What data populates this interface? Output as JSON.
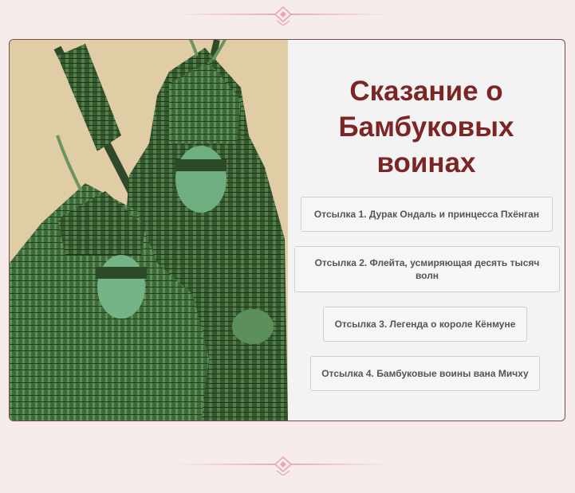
{
  "title": "Сказание о Бамбуковых воинах",
  "references": [
    {
      "label": "Отсылка 1. Дурак Ондаль и принцесса Пхёнган"
    },
    {
      "label": "Отсылка 2. Флейта, усмиряющая десять тысяч волн"
    },
    {
      "label": "Отсылка 3. Легенда о короле Кёнмуне"
    },
    {
      "label": "Отсылка 4. Бамбуковые воины вана Мичху"
    }
  ],
  "colors": {
    "background": "#f6ecec",
    "title": "#7b2525",
    "card_border": "#7a4b4b",
    "art_background": "#e0cda5",
    "divider_accent": "#e8a8b2"
  },
  "image": {
    "subject": "bamboo-warriors-illustration"
  }
}
